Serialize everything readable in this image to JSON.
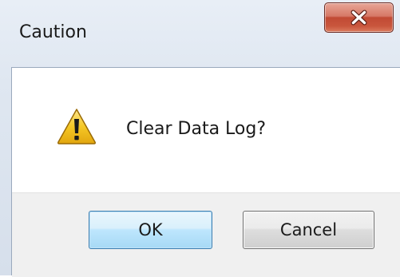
{
  "window": {
    "title": "Caution",
    "close_icon": "close-icon"
  },
  "dialog": {
    "icon": "warning-icon",
    "message": "Clear Data Log?"
  },
  "buttons": {
    "ok_label": "OK",
    "cancel_label": "Cancel"
  },
  "colors": {
    "close_button": "#c9563d",
    "default_button_border": "#3c7fb1",
    "warning_fill": "#f2c21a"
  }
}
